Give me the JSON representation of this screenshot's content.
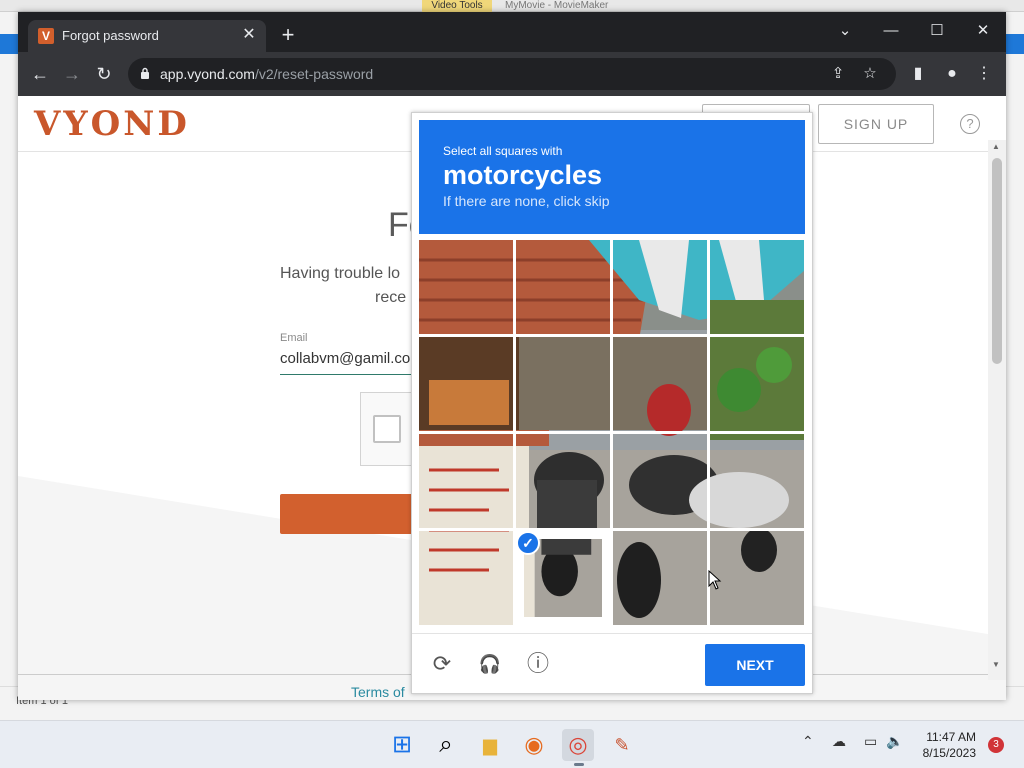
{
  "desktop": {
    "ribbon_tab": "Video Tools",
    "ribbon_title": "MyMovie - MovieMaker",
    "status_text": "Item 1 of 1"
  },
  "browser": {
    "tab_title": "Forgot password",
    "favicon_letter": "V",
    "url_host": "app.vyond.com",
    "url_path": "/v2/reset-password"
  },
  "vyond": {
    "logo_text": "VYOND",
    "signup_label": "SIGN UP",
    "help_label": "?",
    "title_partial": "Fo",
    "subtitle_line1": "Having trouble lo",
    "subtitle_line2": "rece",
    "email_label": "Email",
    "email_value": "collabvm@gamil.co",
    "terms_partial": "Terms of"
  },
  "captcha": {
    "instruction_line1": "Select all squares with",
    "target_object": "motorcycles",
    "instruction_line3": "If there are none, click skip",
    "next_label": "NEXT",
    "check_mark": "✓"
  },
  "icons": {
    "refresh": "⟳",
    "headphones": "🎧",
    "info": "ⓘ",
    "back": "←",
    "forward": "→",
    "reload": "↻",
    "close": "✕",
    "plus": "+",
    "minimize": "—",
    "maximize": "☐",
    "chevron": "⌄",
    "share": "⇪",
    "star": "☆",
    "sidebar": "▮",
    "profile": "●",
    "menu": "⋮",
    "windows": "⊞",
    "search": "⌕",
    "folder": "▆",
    "firefox": "◉",
    "chrome": "◎",
    "moviemaker": "✎",
    "tray_up": "⌃",
    "network": "▭",
    "speaker": "🔈",
    "cloud": "☁"
  },
  "taskbar": {
    "time": "11:47 AM",
    "date": "8/15/2023",
    "notifications": "3"
  },
  "colors": {
    "captcha_blue": "#1a73e8",
    "vyond_orange": "#d2602e",
    "chrome_dark": "#202124"
  }
}
